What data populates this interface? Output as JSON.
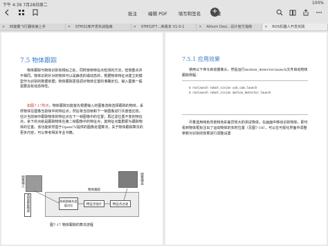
{
  "status": {
    "time": "下午 4:39",
    "date": "7月28日周二",
    "battery": "100%"
  },
  "toolbar": {
    "menu": [
      "批注",
      "编辑 PDF",
      "填写和签名",
      "收藏"
    ],
    "plus": "+"
  },
  "tabs": [
    "四旋翼飞行器快速上手",
    "STM32库开发实战指南",
    "STM32F7...库版本 V1.0-1",
    "Altium Desi...设计官方指南",
    "ROS机器人开发实践"
  ],
  "left_page": {
    "section_title": "7.5 物体跟踪",
    "para1": "物体跟踪与物体识别有相似之处，同样使用特征点检测的方法，但侧重点并不相同。物体识别针对的物体可以是静态的或动态的，根据物体特征点建立的模型作为识别的数据依据；物体跟踪更强调对物体位置的准确定位，输入图像一般需要具有动态特性。",
    "para2_a": "如图7-17所示",
    "para2_b": "，物体跟踪功能首先根据输入的图像流和选择跟踪的物体，采样物体在图像当前帧中的特征点；然后将当前帧和下一帧图像进行灰度值比较，估计当前帧中跟踪物体的特征点在下一帧图像中的位置；再过滤位置不变的特征点，余下的点就是跟踪物体在第二帧图像中的特征点，其特征点集群即为跟踪物体的位置。该功能依然基于OpenCV提供的图像处理算法，关于物体跟踪算法的更多内容，可以参考相关专业书籍。",
    "figure": {
      "input_label": "图像输入",
      "output_label": "图像输出",
      "group_label": "物体跟踪",
      "select_label": "选择跟踪物体",
      "compare_label": "两帧图像灰度值对比",
      "estimate_label": "特征点估计",
      "filter_label": "特征点过滤"
    },
    "caption": "图7-17 物体跟踪的算法流程"
  },
  "right_page": {
    "subsection_title": "7.5.1 应用效果",
    "para1": "使用以下命令启动摄像头，然后运行motion_detector.launch文件启动物体跟踪例程：",
    "commands": [
      "$ roslaunch robot_vision usb_cam.launch",
      "$ roslaunch robot_vision motion_detector.launch"
    ],
    "para2": "尽量选用纯色背景和色彩差异较大的测试物体。在画面中移动识别物体，即可看到物体框标注出了运动物体的实时位置（见图7-18），可以在可视化界面中调整参数对识别的效果进行调整设置"
  }
}
